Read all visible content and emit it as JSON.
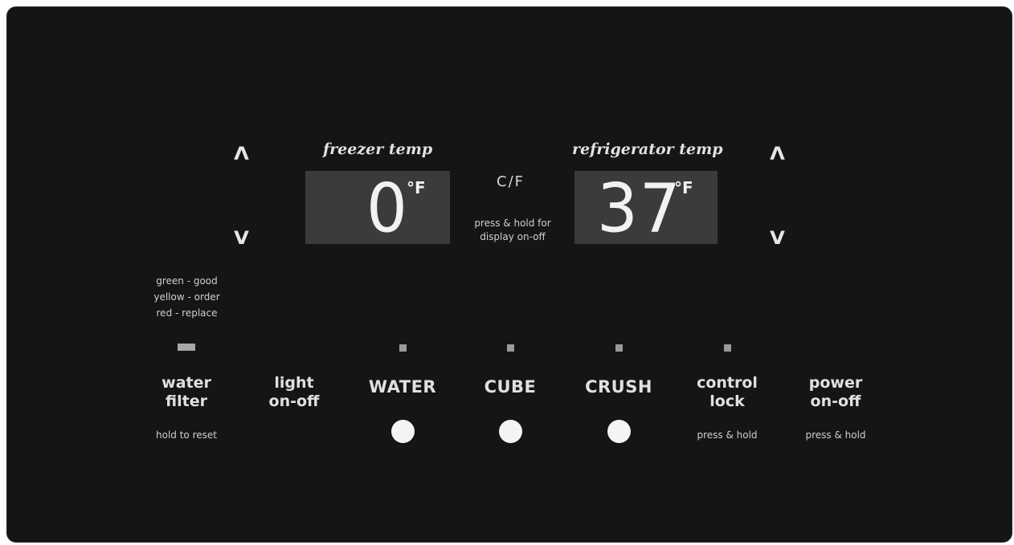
{
  "freezer": {
    "title": "freezer temp",
    "value": "0",
    "unit": "°F",
    "up_symbol": "Λ",
    "down_symbol": "V"
  },
  "refrigerator": {
    "title": "refrigerator temp",
    "value": "37",
    "unit": "°F",
    "up_symbol": "Λ",
    "down_symbol": "V"
  },
  "cf": {
    "label": "C/F",
    "hint_line1": "press & hold for",
    "hint_line2": "display on-off"
  },
  "water_filter": {
    "legend": [
      "green - good",
      "yellow - order",
      "red - replace"
    ],
    "label_line1": "water",
    "label_line2": "filter",
    "hint": "hold to reset"
  },
  "light": {
    "label_line1": "light",
    "label_line2": "on-off"
  },
  "dispense": {
    "water": "WATER",
    "cube": "CUBE",
    "crush": "CRUSH"
  },
  "control_lock": {
    "label_line1": "control",
    "label_line2": "lock",
    "hint": "press & hold"
  },
  "power": {
    "label_line1": "power",
    "label_line2": "on-off",
    "hint": "press & hold"
  }
}
